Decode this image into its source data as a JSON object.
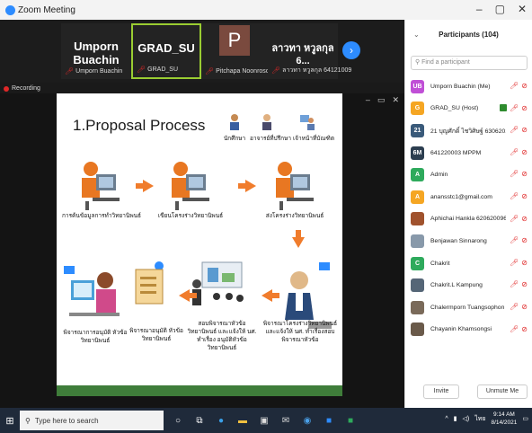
{
  "window": {
    "title": "Zoom Meeting"
  },
  "strip": {
    "tiles": [
      {
        "name": "Umporn Buachin",
        "sub": "Umporn Buachin"
      },
      {
        "name": "GRAD_SU",
        "sub": "GRAD_SU"
      },
      {
        "name": "P",
        "sub": "Pitchapa Noonrosoi"
      },
      {
        "name": "ลาวทา หวูลกุล 6...",
        "sub": "ลาวทา หวูลกุล 64121009"
      }
    ]
  },
  "recording": {
    "label": "Recording"
  },
  "slide": {
    "title": "1.Proposal Process",
    "roles": [
      "นักศึกษา",
      "อาจารย์ที่ปรึกษา",
      "เจ้าหน้าที่บัณฑิต"
    ],
    "steps": [
      "การค้นข้อมูลการทำวิทยานิพนธ์",
      "เขียนโครงร่างวิทยานิพนธ์",
      "ส่งโครงร่างวิทยานิพนธ์",
      "พิจารณาโครงร่างวิทยานิพนธ์ และแจ้งให้ นศ. ทำเรื่องสอบ พิจารณาหัวข้อ",
      "สอบพิจารณาหัวข้อวิทยานิพนธ์ และแจ้งให้ นศ. ทำเรื่อง อนุมัติหัวข้อวิทยานิพนธ์",
      "พิจารณาอนุมัติ หัวข้อวิทยานิพนธ์",
      "พิจารณาการอนุมัติ หัวข้อวิทยานิพนธ์"
    ]
  },
  "participants": {
    "title": "Participants (104)",
    "search_placeholder": "Find a participant",
    "list": [
      {
        "initials": "UB",
        "name": "Umporn Buachin (Me)",
        "color": "#c04fd6"
      },
      {
        "initials": "G",
        "name": "GRAD_SU (Host)",
        "color": "#f5a623"
      },
      {
        "initials": "21",
        "name": "21 บุญศักดิ์ ไชวิศิษฐ์ 63062014...",
        "color": "#3a5a7a"
      },
      {
        "initials": "6M",
        "name": "641220003 MPPM",
        "color": "#2c3e50"
      },
      {
        "initials": "A",
        "name": "Admin",
        "color": "#2eaa5c"
      },
      {
        "initials": "A",
        "name": "anansstc1@gmail.com",
        "color": "#f5a623"
      },
      {
        "initials": "",
        "name": "Aphichai Hankla 620620096",
        "color": "#a0522d"
      },
      {
        "initials": "",
        "name": "Benjawan Sinnarong",
        "color": "#8899aa"
      },
      {
        "initials": "C",
        "name": "Chakrit",
        "color": "#2eaa5c"
      },
      {
        "initials": "",
        "name": "Chakrit.L Kampung",
        "color": "#556677"
      },
      {
        "initials": "",
        "name": "Chalermporn Tuangsophon",
        "color": "#7a6a5a"
      },
      {
        "initials": "",
        "name": "Chayanin Khamsongsi",
        "color": "#6a5a4a"
      }
    ],
    "invite_label": "Invite",
    "unmute_label": "Unmute Me"
  },
  "taskbar": {
    "search_placeholder": "Type here to search",
    "time": "9:14 AM",
    "date": "8/14/2021",
    "lang": "ไทย"
  }
}
